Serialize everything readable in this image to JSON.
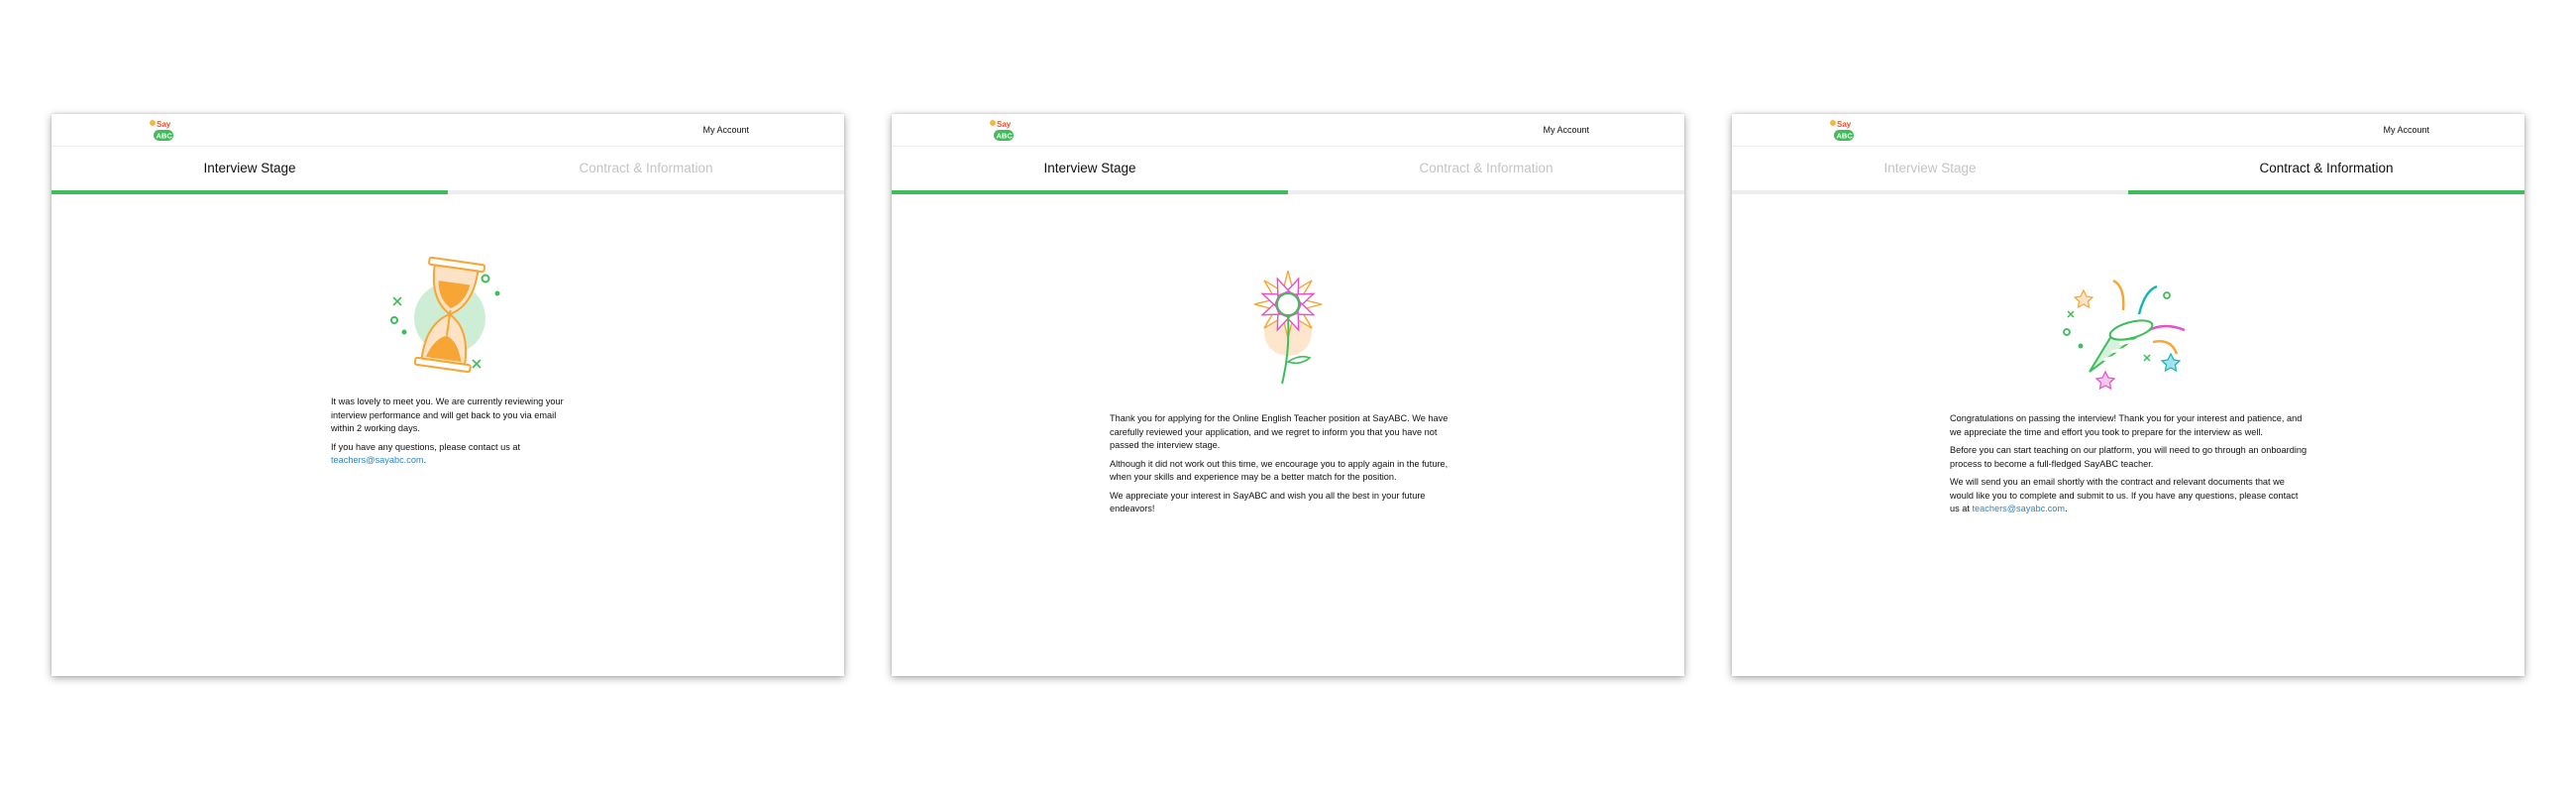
{
  "account_label": "My Account",
  "tabs": {
    "interview": "Interview Stage",
    "contract": "Contract & Information"
  },
  "email": "teachers@sayabc.com",
  "panels": {
    "reviewing": {
      "p1": "It was lovely to meet you. We are currently reviewing your interview performance and will get back to you via email within 2 working days.",
      "p2_prefix": "If you have any questions, please contact us at"
    },
    "rejected": {
      "p1": "Thank you for applying for the Online English Teacher position at SayABC. We have carefully reviewed your application, and we regret to inform you that you have not passed the interview stage.",
      "p2": "Although it did not work out this time, we encourage you to apply again in the future, when your skills and experience may be a better match for the position.",
      "p3": "We appreciate your interest in SayABC and wish you all the best in your future endeavors!"
    },
    "passed": {
      "p1": "Congratulations on passing the interview! Thank you for your interest and patience, and we appreciate the time and effort you took to prepare for the interview as well.",
      "p2": "Before you can start teaching on our platform, you will need to go through an onboarding process to become a full-fledged SayABC teacher.",
      "p3_prefix": "We will send you an email shortly with the contract and relevant documents that we would like you to complete and submit to us. If you have any questions, please contact us at"
    }
  }
}
